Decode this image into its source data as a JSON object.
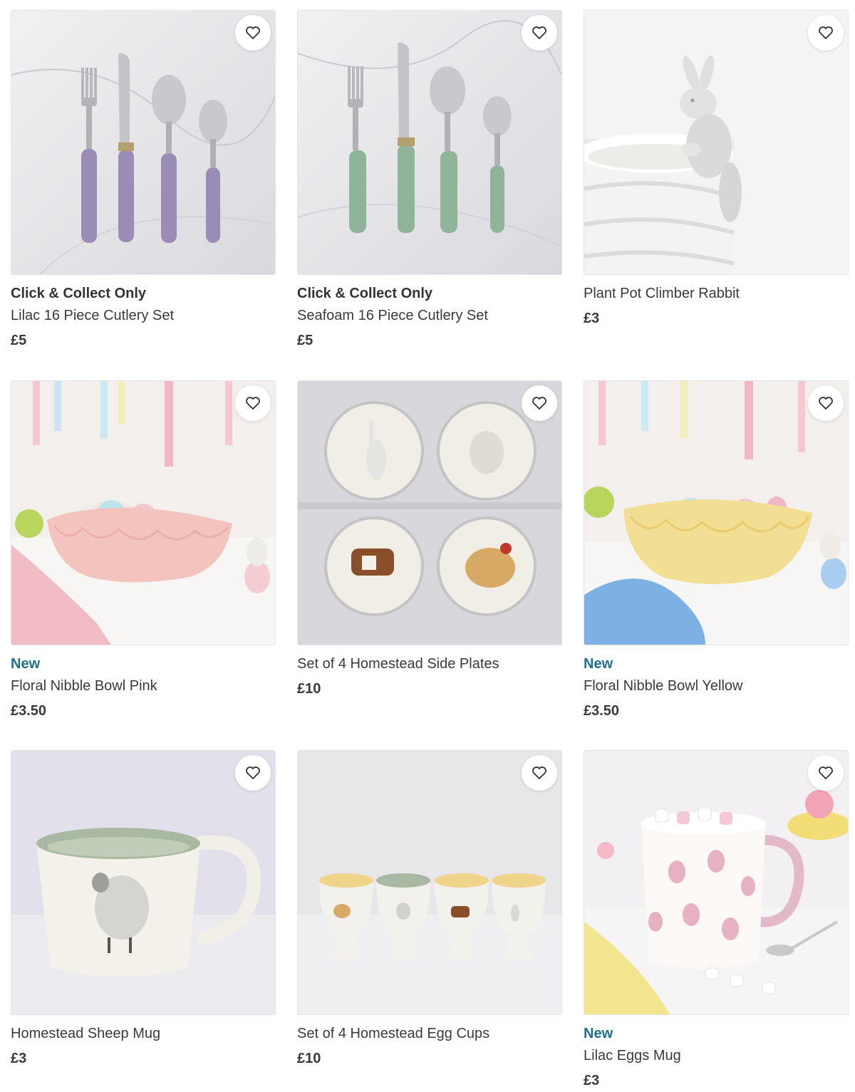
{
  "products": [
    {
      "tag": "Click & Collect Only",
      "name": "Lilac 16 Piece Cutlery Set",
      "price": "£5",
      "image": "lilac-cutlery-image",
      "accent": "#9a8cb5"
    },
    {
      "tag": "Click & Collect Only",
      "name": "Seafoam 16 Piece Cutlery Set",
      "price": "£5",
      "image": "seafoam-cutlery-image",
      "accent": "#8fb49a"
    },
    {
      "tag": "",
      "name": "Plant Pot Climber Rabbit",
      "price": "£3",
      "image": "rabbit-pot-image",
      "accent": "#e8e8e6"
    },
    {
      "tag": "New",
      "name": "Floral Nibble Bowl Pink",
      "price": "£3.50",
      "image": "pink-bowl-image",
      "accent": "#f2c4bd"
    },
    {
      "tag": "",
      "name": "Set of 4 Homestead Side Plates",
      "price": "£10",
      "image": "side-plates-image",
      "accent": "#f1eee6"
    },
    {
      "tag": "New",
      "name": "Floral Nibble Bowl Yellow",
      "price": "£3.50",
      "image": "yellow-bowl-image",
      "accent": "#f2df93"
    },
    {
      "tag": "",
      "name": "Homestead Sheep Mug",
      "price": "£3",
      "image": "sheep-mug-image",
      "accent": "#a9b8a2"
    },
    {
      "tag": "",
      "name": "Set of 4 Homestead Egg Cups",
      "price": "£10",
      "image": "egg-cups-image",
      "accent": "#f0d48a"
    },
    {
      "tag": "New",
      "name": "Lilac Eggs Mug",
      "price": "£3",
      "image": "lilac-mug-image",
      "accent": "#e3b8c8"
    }
  ],
  "favourite_icon": "heart-outline-icon",
  "colors": {
    "new_tag": "#1f6f8b",
    "text": "#3a3a3a"
  }
}
